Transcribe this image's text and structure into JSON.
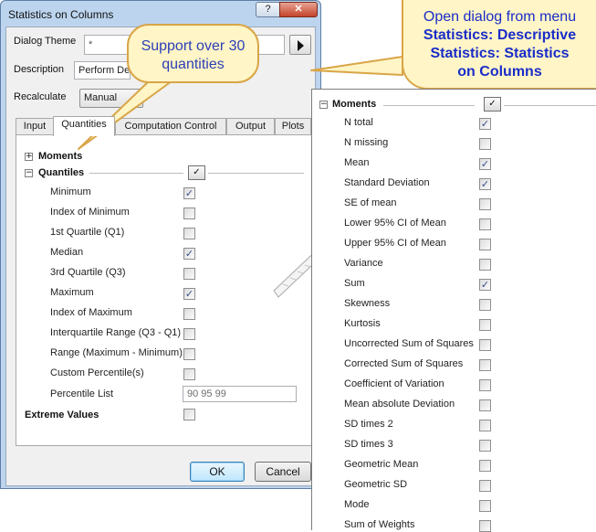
{
  "dialog": {
    "title": "Statistics on Columns",
    "help_label": "?",
    "close_label": "✕",
    "dialog_theme_label": "Dialog Theme",
    "dialog_theme_value": "*",
    "description_label": "Description",
    "description_value": "Perform De",
    "recalculate_label": "Recalculate",
    "recalculate_value": "Manual",
    "tabs": [
      "Input",
      "Quantities",
      "Computation Control",
      "Output",
      "Plots"
    ],
    "active_tab": "Quantities",
    "moments_label": "Moments",
    "quantiles_label": "Quantiles",
    "quantiles": [
      {
        "label": "Minimum",
        "checked": true
      },
      {
        "label": "Index of Minimum",
        "checked": false
      },
      {
        "label": "1st Quartile (Q1)",
        "checked": false
      },
      {
        "label": "Median",
        "checked": true
      },
      {
        "label": "3rd Quartile (Q3)",
        "checked": false
      },
      {
        "label": "Maximum",
        "checked": true
      },
      {
        "label": "Index of Maximum",
        "checked": false
      },
      {
        "label": "Interquartile Range (Q3 - Q1)",
        "checked": false
      },
      {
        "label": "Range (Maximum - Minimum)",
        "checked": false
      },
      {
        "label": "Custom Percentile(s)",
        "checked": false
      }
    ],
    "percentile_list_label": "Percentile List",
    "percentile_list_value": "90 95 99",
    "extreme_values_label": "Extreme Values",
    "ok_label": "OK",
    "cancel_label": "Cancel",
    "header_check_glyph": "✓"
  },
  "callouts": {
    "quantities_line1": "Support over 30",
    "quantities_line2": "quantities",
    "menu_line1": "Open dialog from menu",
    "menu_line2": "Statistics: Descriptive",
    "menu_line3": "Statistics: Statistics",
    "menu_line4": "on Columns"
  },
  "moments_panel": {
    "title": "Moments",
    "items": [
      {
        "label": "N total",
        "checked": true
      },
      {
        "label": "N missing",
        "checked": false
      },
      {
        "label": "Mean",
        "checked": true
      },
      {
        "label": "Standard Deviation",
        "checked": true
      },
      {
        "label": "SE of mean",
        "checked": false
      },
      {
        "label": "Lower 95% CI of Mean",
        "checked": false
      },
      {
        "label": "Upper 95% CI of Mean",
        "checked": false
      },
      {
        "label": "Variance",
        "checked": false
      },
      {
        "label": "Sum",
        "checked": true
      },
      {
        "label": "Skewness",
        "checked": false
      },
      {
        "label": "Kurtosis",
        "checked": false
      },
      {
        "label": "Uncorrected Sum of Squares",
        "checked": false
      },
      {
        "label": "Corrected Sum of Squares",
        "checked": false
      },
      {
        "label": "Coefficient of Variation",
        "checked": false
      },
      {
        "label": "Mean absolute Deviation",
        "checked": false
      },
      {
        "label": "SD times 2",
        "checked": false
      },
      {
        "label": "SD times 3",
        "checked": false
      },
      {
        "label": "Geometric Mean",
        "checked": false
      },
      {
        "label": "Geometric SD",
        "checked": false
      },
      {
        "label": "Mode",
        "checked": false
      },
      {
        "label": "Sum of Weights",
        "checked": false
      }
    ]
  },
  "colors": {
    "callout_fill": "#fff5c6",
    "callout_border": "#d9a547",
    "callout_text": "#2b3fb9",
    "window_frame": "#bcd4ee"
  }
}
